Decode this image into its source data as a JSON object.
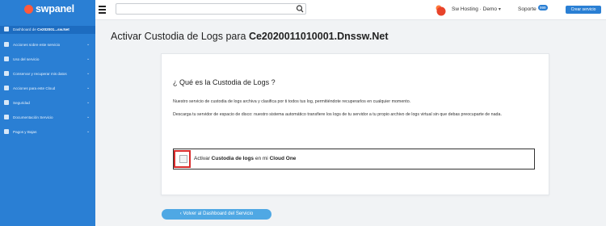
{
  "brand": {
    "name": "swpanel"
  },
  "topbar": {
    "search_value": "",
    "account_label": "Sw Hosting · Demo",
    "support_label": "Soporte",
    "support_badge": "999",
    "create_label": "Crear servicio"
  },
  "sidebar": {
    "items": [
      {
        "label": "Dashboard de ",
        "bold": "Ce202001...sw.Net",
        "active": true,
        "icon": "dashboard-icon"
      },
      {
        "label": "Acciones sobre este servicio",
        "icon": "gear-icon"
      },
      {
        "label": "Uso del servicio",
        "icon": "chart-icon"
      },
      {
        "label": "Conservar y recuperar mis datos",
        "icon": "backup-icon"
      },
      {
        "label": "Acciones para este Cloud",
        "icon": "cloud-icon"
      },
      {
        "label": "Seguridad",
        "icon": "shield-icon"
      },
      {
        "label": "Documentación Servicio",
        "icon": "document-icon"
      },
      {
        "label": "Pagos y Bajas",
        "icon": "payment-icon"
      }
    ]
  },
  "main": {
    "title_prefix": "Activar Custodia de Logs para ",
    "title_bold": "Ce2020011010001.Dnssw.Net",
    "question": "¿ Qué es la Custodia de Logs ?",
    "paragraph1": "Nuestro servicio de custodia de logs archiva y clasifica por ti todos tus log, permitiéndote recuperarlos en cualquier momento.",
    "paragraph2": "Descarga tu servidor de espacio de disco: nuestro sistema automático transfiere los logs de tu servidor a tu propio archivo de logs virtual sin que debas preocuparte de nada.",
    "option": {
      "pre": "Activar ",
      "bold1": "Custodia de logs",
      "mid": " en mi ",
      "bold2": "Cloud One",
      "checked": false
    },
    "back_label": "Volver al Dashboard del Servicio"
  },
  "colors": {
    "brand": "#2a7fd4",
    "accent": "#ff5a3c",
    "highlight": "#d92b2b",
    "button": "#4fa8e4"
  }
}
